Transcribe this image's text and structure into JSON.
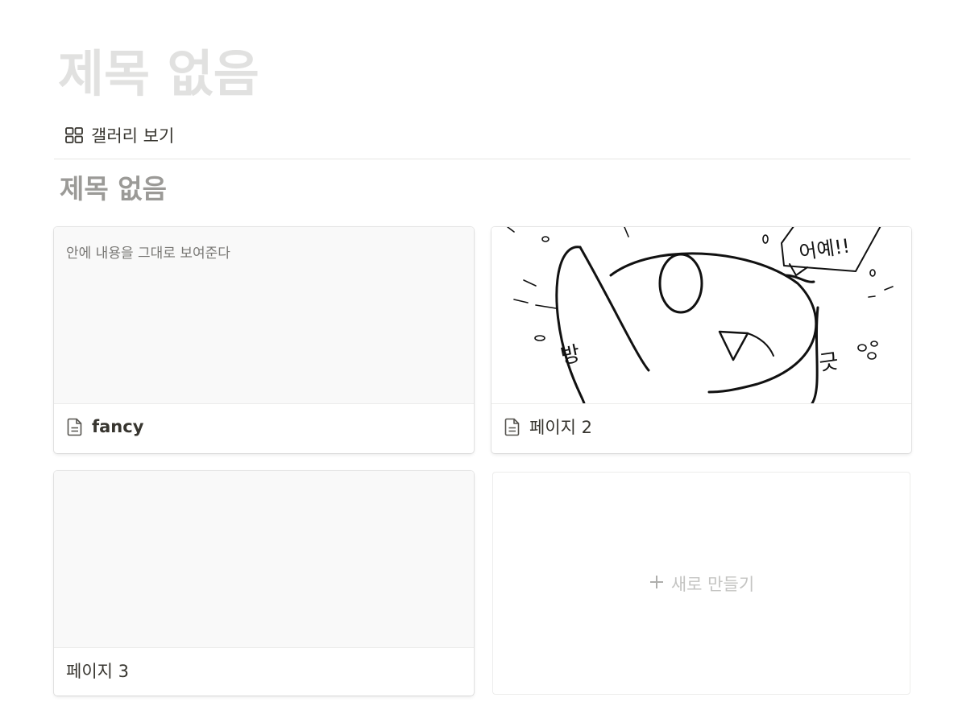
{
  "page": {
    "title": "제목 없음"
  },
  "view": {
    "tab_label": "갤러리 보기",
    "tab_icon": "grid-icon"
  },
  "collection": {
    "title": "제목 없음"
  },
  "cards": [
    {
      "name": "fancy",
      "preview_text": "안에 내용을 그대로 보여준다",
      "icon": "document-icon"
    },
    {
      "name": "페이지 2",
      "preview_image": "comic-illustration",
      "preview_text_in_image": "어예!!",
      "preview_sfx_left": "방",
      "preview_sfx_right": "긋",
      "icon": "document-icon"
    },
    {
      "name": "페이지 3"
    }
  ],
  "new_card": {
    "label": "새로 만들기",
    "icon": "plus-icon"
  }
}
